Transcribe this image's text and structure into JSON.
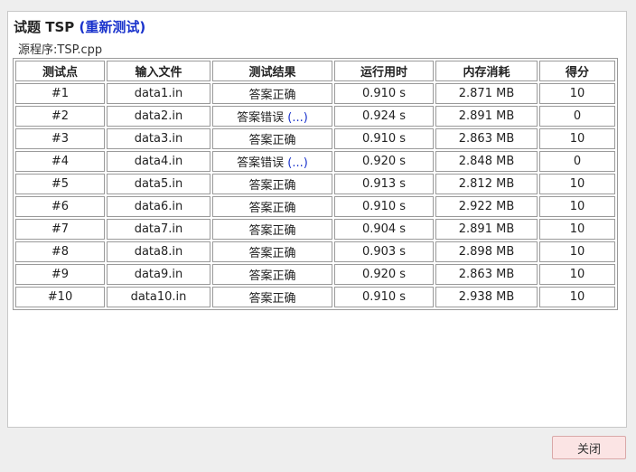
{
  "header": {
    "title": "试题 TSP",
    "retest_label": "(重新测试)",
    "source_label": "源程序:TSP.cpp"
  },
  "table": {
    "columns": [
      "测试点",
      "输入文件",
      "测试结果",
      "运行用时",
      "内存消耗",
      "得分"
    ],
    "rows": [
      {
        "point": "#1",
        "file": "data1.in",
        "result": "答案正确",
        "detail": "",
        "time": "0.910 s",
        "memory": "2.871 MB",
        "score": "10"
      },
      {
        "point": "#2",
        "file": "data2.in",
        "result": "答案错误",
        "detail": "(...)",
        "time": "0.924 s",
        "memory": "2.891 MB",
        "score": "0"
      },
      {
        "point": "#3",
        "file": "data3.in",
        "result": "答案正确",
        "detail": "",
        "time": "0.910 s",
        "memory": "2.863 MB",
        "score": "10"
      },
      {
        "point": "#4",
        "file": "data4.in",
        "result": "答案错误",
        "detail": "(...)",
        "time": "0.920 s",
        "memory": "2.848 MB",
        "score": "0"
      },
      {
        "point": "#5",
        "file": "data5.in",
        "result": "答案正确",
        "detail": "",
        "time": "0.913 s",
        "memory": "2.812 MB",
        "score": "10"
      },
      {
        "point": "#6",
        "file": "data6.in",
        "result": "答案正确",
        "detail": "",
        "time": "0.910 s",
        "memory": "2.922 MB",
        "score": "10"
      },
      {
        "point": "#7",
        "file": "data7.in",
        "result": "答案正确",
        "detail": "",
        "time": "0.904 s",
        "memory": "2.891 MB",
        "score": "10"
      },
      {
        "point": "#8",
        "file": "data8.in",
        "result": "答案正确",
        "detail": "",
        "time": "0.903 s",
        "memory": "2.898 MB",
        "score": "10"
      },
      {
        "point": "#9",
        "file": "data9.in",
        "result": "答案正确",
        "detail": "",
        "time": "0.920 s",
        "memory": "2.863 MB",
        "score": "10"
      },
      {
        "point": "#10",
        "file": "data10.in",
        "result": "答案正确",
        "detail": "",
        "time": "0.910 s",
        "memory": "2.938 MB",
        "score": "10"
      }
    ]
  },
  "footer": {
    "close_label": "关闭"
  },
  "colors": {
    "link": "#1a33cc",
    "close_button_bg": "#fbe4e4",
    "border": "#9a9a9a"
  }
}
